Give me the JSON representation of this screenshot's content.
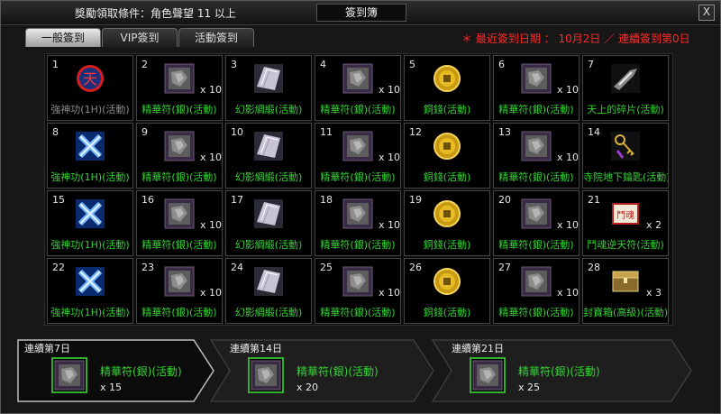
{
  "window": {
    "requirement": "獎勵領取條件：角色聲望 11 以上",
    "title": "簽到簿",
    "close": "X"
  },
  "tabs": [
    {
      "label": "一般簽到",
      "active": true
    },
    {
      "label": "VIP簽到",
      "active": false
    },
    {
      "label": "活動簽到",
      "active": false
    }
  ],
  "notice": {
    "prefix": "＊ 最近簽到日期 ： 10月2日 ／ 連續簽到第",
    "days": "0",
    "suffix": "日"
  },
  "rewards": [
    {
      "day": "1",
      "name": "強神功(1H)(活動)",
      "qty": "",
      "icon": "tian-icon",
      "dim": true
    },
    {
      "day": "2",
      "name": "精華符(銀)(活動)",
      "qty": "x 10",
      "icon": "charm-icon"
    },
    {
      "day": "3",
      "name": "幻影綢緞(活動)",
      "qty": "",
      "icon": "silk-icon"
    },
    {
      "day": "4",
      "name": "精華符(銀)(活動)",
      "qty": "x 10",
      "icon": "charm-icon"
    },
    {
      "day": "5",
      "name": "銅錢(活動)",
      "qty": "",
      "icon": "coin-icon"
    },
    {
      "day": "6",
      "name": "精華符(銀)(活動)",
      "qty": "x 10",
      "icon": "charm-icon"
    },
    {
      "day": "7",
      "name": "天上的碎片(活動)",
      "qty": "",
      "icon": "shard-icon"
    },
    {
      "day": "8",
      "name": "強神功(1H)(活動)",
      "qty": "",
      "icon": "cross-icon"
    },
    {
      "day": "9",
      "name": "精華符(銀)(活動)",
      "qty": "x 10",
      "icon": "charm-icon"
    },
    {
      "day": "10",
      "name": "幻影綢緞(活動)",
      "qty": "",
      "icon": "silk-icon"
    },
    {
      "day": "11",
      "name": "精華符(銀)(活動)",
      "qty": "x 10",
      "icon": "charm-icon"
    },
    {
      "day": "12",
      "name": "銅錢(活動)",
      "qty": "",
      "icon": "coin-icon"
    },
    {
      "day": "13",
      "name": "精華符(銀)(活動)",
      "qty": "x 10",
      "icon": "charm-icon"
    },
    {
      "day": "14",
      "name": "寺院地下鑰匙(活動)",
      "qty": "",
      "icon": "key-icon"
    },
    {
      "day": "15",
      "name": "強神功(1H)(活動)",
      "qty": "",
      "icon": "cross-icon"
    },
    {
      "day": "16",
      "name": "精華符(銀)(活動)",
      "qty": "x 10",
      "icon": "charm-icon"
    },
    {
      "day": "17",
      "name": "幻影綢緞(活動)",
      "qty": "",
      "icon": "silk-icon"
    },
    {
      "day": "18",
      "name": "精華符(銀)(活動)",
      "qty": "x 10",
      "icon": "charm-icon"
    },
    {
      "day": "19",
      "name": "銅錢(活動)",
      "qty": "",
      "icon": "coin-icon"
    },
    {
      "day": "20",
      "name": "精華符(銀)(活動)",
      "qty": "x 10",
      "icon": "charm-icon"
    },
    {
      "day": "21",
      "name": "鬥魂逆天符(活動)",
      "qty": "x 2",
      "icon": "scroll-icon"
    },
    {
      "day": "22",
      "name": "強神功(1H)(活動)",
      "qty": "",
      "icon": "cross-icon"
    },
    {
      "day": "23",
      "name": "精華符(銀)(活動)",
      "qty": "x 10",
      "icon": "charm-icon"
    },
    {
      "day": "24",
      "name": "幻影綢緞(活動)",
      "qty": "",
      "icon": "silk-icon"
    },
    {
      "day": "25",
      "name": "精華符(銀)(活動)",
      "qty": "x 10",
      "icon": "charm-icon"
    },
    {
      "day": "26",
      "name": "銅錢(活動)",
      "qty": "",
      "icon": "coin-icon"
    },
    {
      "day": "27",
      "name": "精華符(銀)(活動)",
      "qty": "x 10",
      "icon": "charm-icon"
    },
    {
      "day": "28",
      "name": "封寶箱(高級)(活動)",
      "qty": "x 3",
      "icon": "chest-icon"
    }
  ],
  "streaks": [
    {
      "label": "連續第7日",
      "name": "精華符(銀)(活動)",
      "qty": "x 15",
      "icon": "charm-icon"
    },
    {
      "label": "連續第14日",
      "name": "精華符(銀)(活動)",
      "qty": "x 20",
      "icon": "charm-icon"
    },
    {
      "label": "連續第21日",
      "name": "精華符(銀)(活動)",
      "qty": "x 25",
      "icon": "charm-icon"
    }
  ]
}
